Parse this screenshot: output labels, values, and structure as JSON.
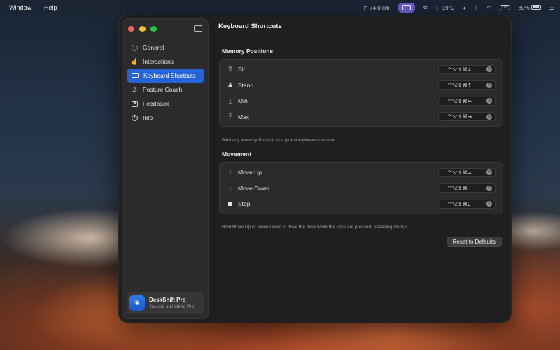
{
  "menubar": {
    "items": [
      "Window",
      "Help"
    ],
    "height_readout": "74,0 cm",
    "temperature": "19°C",
    "input_source": "US",
    "battery": "80%"
  },
  "sidebar": {
    "items": [
      {
        "label": "General",
        "icon": "gear-icon"
      },
      {
        "label": "Interactions",
        "icon": "hand-icon"
      },
      {
        "label": "Keyboard Shortcuts",
        "icon": "keyboard-icon",
        "active": true
      },
      {
        "label": "Posture Coach",
        "icon": "coach-icon"
      },
      {
        "label": "Feedback",
        "icon": "feedback-icon"
      },
      {
        "label": "Info",
        "icon": "info-icon"
      }
    ],
    "pro": {
      "title": "DeskShift Pro",
      "subtitle": "You are a Lifetime Pro"
    }
  },
  "main": {
    "title": "Keyboard Shortcuts",
    "memory_section": {
      "title": "Memory Positions",
      "rows": [
        {
          "label": "Sit",
          "shortcut": "^⌥⇧⌘↓"
        },
        {
          "label": "Stand",
          "shortcut": "^⌥⇧⌘↑"
        },
        {
          "label": "Min",
          "shortcut": "^⌥⇧⌘←"
        },
        {
          "label": "Max",
          "shortcut": "^⌥⇧⌘→"
        }
      ],
      "note": "Bind any Memory Position to a global keyboard shortcut."
    },
    "movement_section": {
      "title": "Movement",
      "rows": [
        {
          "label": "Move Up",
          "shortcut": "^⌥⇧⌘="
        },
        {
          "label": "Move Down",
          "shortcut": "^⌥⇧⌘-"
        },
        {
          "label": "Stop",
          "shortcut": "^⌥⇧⌘0"
        }
      ],
      "note": "Hold Move Up or Move Down to drive the desk while the keys are pressed; releasing stops it."
    },
    "reset_label": "Reset to Defaults"
  },
  "colors": {
    "accent": "#2563d8",
    "window_bg": "#1f1f1f",
    "sidebar_bg": "#2b2b2b"
  }
}
